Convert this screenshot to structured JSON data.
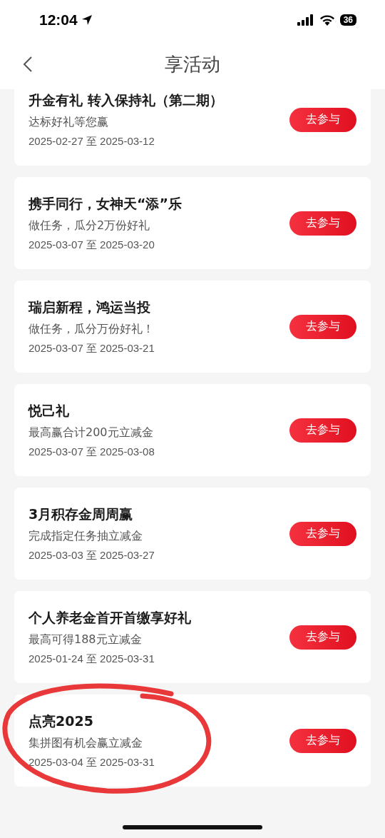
{
  "status_bar": {
    "time": "12:04",
    "battery": "36"
  },
  "header": {
    "title": "享活动"
  },
  "activities": [
    {
      "title": "升金有礼 转入保持礼（第二期）",
      "subtitle": "达标好礼等您赢",
      "dates": "2025-02-27 至 2025-03-12",
      "button": "去参与"
    },
    {
      "title": "携手同行，女神天“添”乐",
      "subtitle": "做任务，瓜分2万份好礼",
      "dates": "2025-03-07 至 2025-03-20",
      "button": "去参与"
    },
    {
      "title": "瑞启新程，鸿运当投",
      "subtitle": "做任务，瓜分万份好礼！",
      "dates": "2025-03-07 至 2025-03-21",
      "button": "去参与"
    },
    {
      "title": "悦己礼",
      "subtitle": "最高赢合计200元立减金",
      "dates": "2025-03-07 至 2025-03-08",
      "button": "去参与"
    },
    {
      "title": "3月积存金周周赢",
      "subtitle": "完成指定任务抽立减金",
      "dates": "2025-03-03 至 2025-03-27",
      "button": "去参与"
    },
    {
      "title": "个人养老金首开首缴享好礼",
      "subtitle": "最高可得188元立减金",
      "dates": "2025-01-24 至 2025-03-31",
      "button": "去参与"
    },
    {
      "title": "点亮2025",
      "subtitle": "集拼图有机会赢立减金",
      "dates": "2025-03-04 至 2025-03-31",
      "button": "去参与"
    }
  ]
}
